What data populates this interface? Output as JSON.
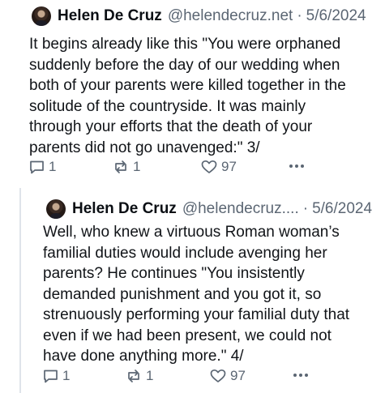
{
  "post1": {
    "author_name": "Helen De Cruz",
    "handle": "@helendecruz.net",
    "separator": "·",
    "date": "5/6/2024",
    "text": "It begins already like this \"You were orphaned\nsuddenly before the day of our wedding when\nboth of your parents were killed together in the\nsolitude of the countryside. It was mainly\nthrough your efforts that the death of your\nparents did not go unavenged:\" 3/",
    "replies": "1",
    "reposts": "1",
    "likes": "97"
  },
  "post2": {
    "author_name": "Helen De Cruz",
    "handle": "@helendecruz....",
    "separator": "·",
    "date": "5/6/2024",
    "text": "Well, who knew a virtuous Roman woman’s\nfamilial duties would include avenging her\nparents? He continues \"You insistently\ndemanded punishment and you got it, so\nstrenuously performing your familial duty that\neven if we had been present, we could not\nhave done anything more.\" 4/",
    "replies": "1",
    "reposts": "1",
    "likes": "97"
  },
  "icons": {
    "reply": "reply-icon",
    "repost": "repost-icon",
    "like": "heart-icon",
    "more": "more-icon"
  },
  "colors": {
    "text": "#111418",
    "muted": "#5b6673",
    "divider": "#dfe4ea"
  }
}
